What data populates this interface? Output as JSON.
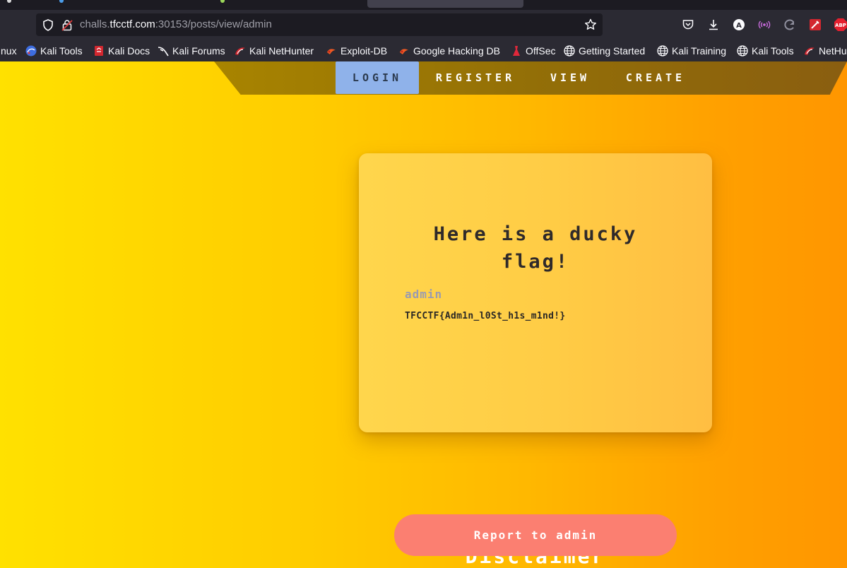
{
  "browser": {
    "url_host": "challs.",
    "url_domain": "tfcctf.com",
    "url_path": ":30153/posts/view/admin",
    "extensions": [
      {
        "name": "pocket-icon"
      },
      {
        "name": "download-icon"
      },
      {
        "name": "account-icon",
        "text": "A"
      },
      {
        "name": "broadcast-icon"
      },
      {
        "name": "refresh-extension-icon"
      },
      {
        "name": "tool-extension-icon"
      },
      {
        "name": "adblock-icon",
        "text": "ABP"
      }
    ]
  },
  "bookmarks": [
    {
      "label": "nux",
      "icon": "none"
    },
    {
      "label": "Kali Tools",
      "icon": "kali-tools-icon"
    },
    {
      "label": "Kali Docs",
      "icon": "kali-docs-icon"
    },
    {
      "label": "Kali Forums",
      "icon": "kali-forums-icon"
    },
    {
      "label": "Kali NetHunter",
      "icon": "nethunter-icon"
    },
    {
      "label": "Exploit-DB",
      "icon": "exploit-db-icon"
    },
    {
      "label": "Google Hacking DB",
      "icon": "ghdb-icon"
    },
    {
      "label": "OffSec",
      "icon": "offsec-icon"
    },
    {
      "label": "Getting Started",
      "icon": "globe-icon"
    },
    {
      "label": "Kali Training",
      "icon": "globe-icon"
    },
    {
      "label": "Kali Tools",
      "icon": "globe-icon"
    },
    {
      "label": "NetHu",
      "icon": "nethunter-icon"
    }
  ],
  "site_nav": {
    "login": "LOGIN",
    "register": "REGISTER",
    "view": "VIEW",
    "create": "CREATE",
    "active": "login"
  },
  "post": {
    "title": "Here is a ducky flag!",
    "author": "admin",
    "content": "TFCCTF{Adm1n_l0St_h1s_m1nd!}"
  },
  "footer": {
    "report_label": "Report to admin",
    "disclaimer_heading": "Disclaimer"
  },
  "colors": {
    "nav_active": "#8fb2ea",
    "report_button": "#fb7f71",
    "gradient_start": "#ffe100",
    "gradient_end": "#ff9600"
  }
}
